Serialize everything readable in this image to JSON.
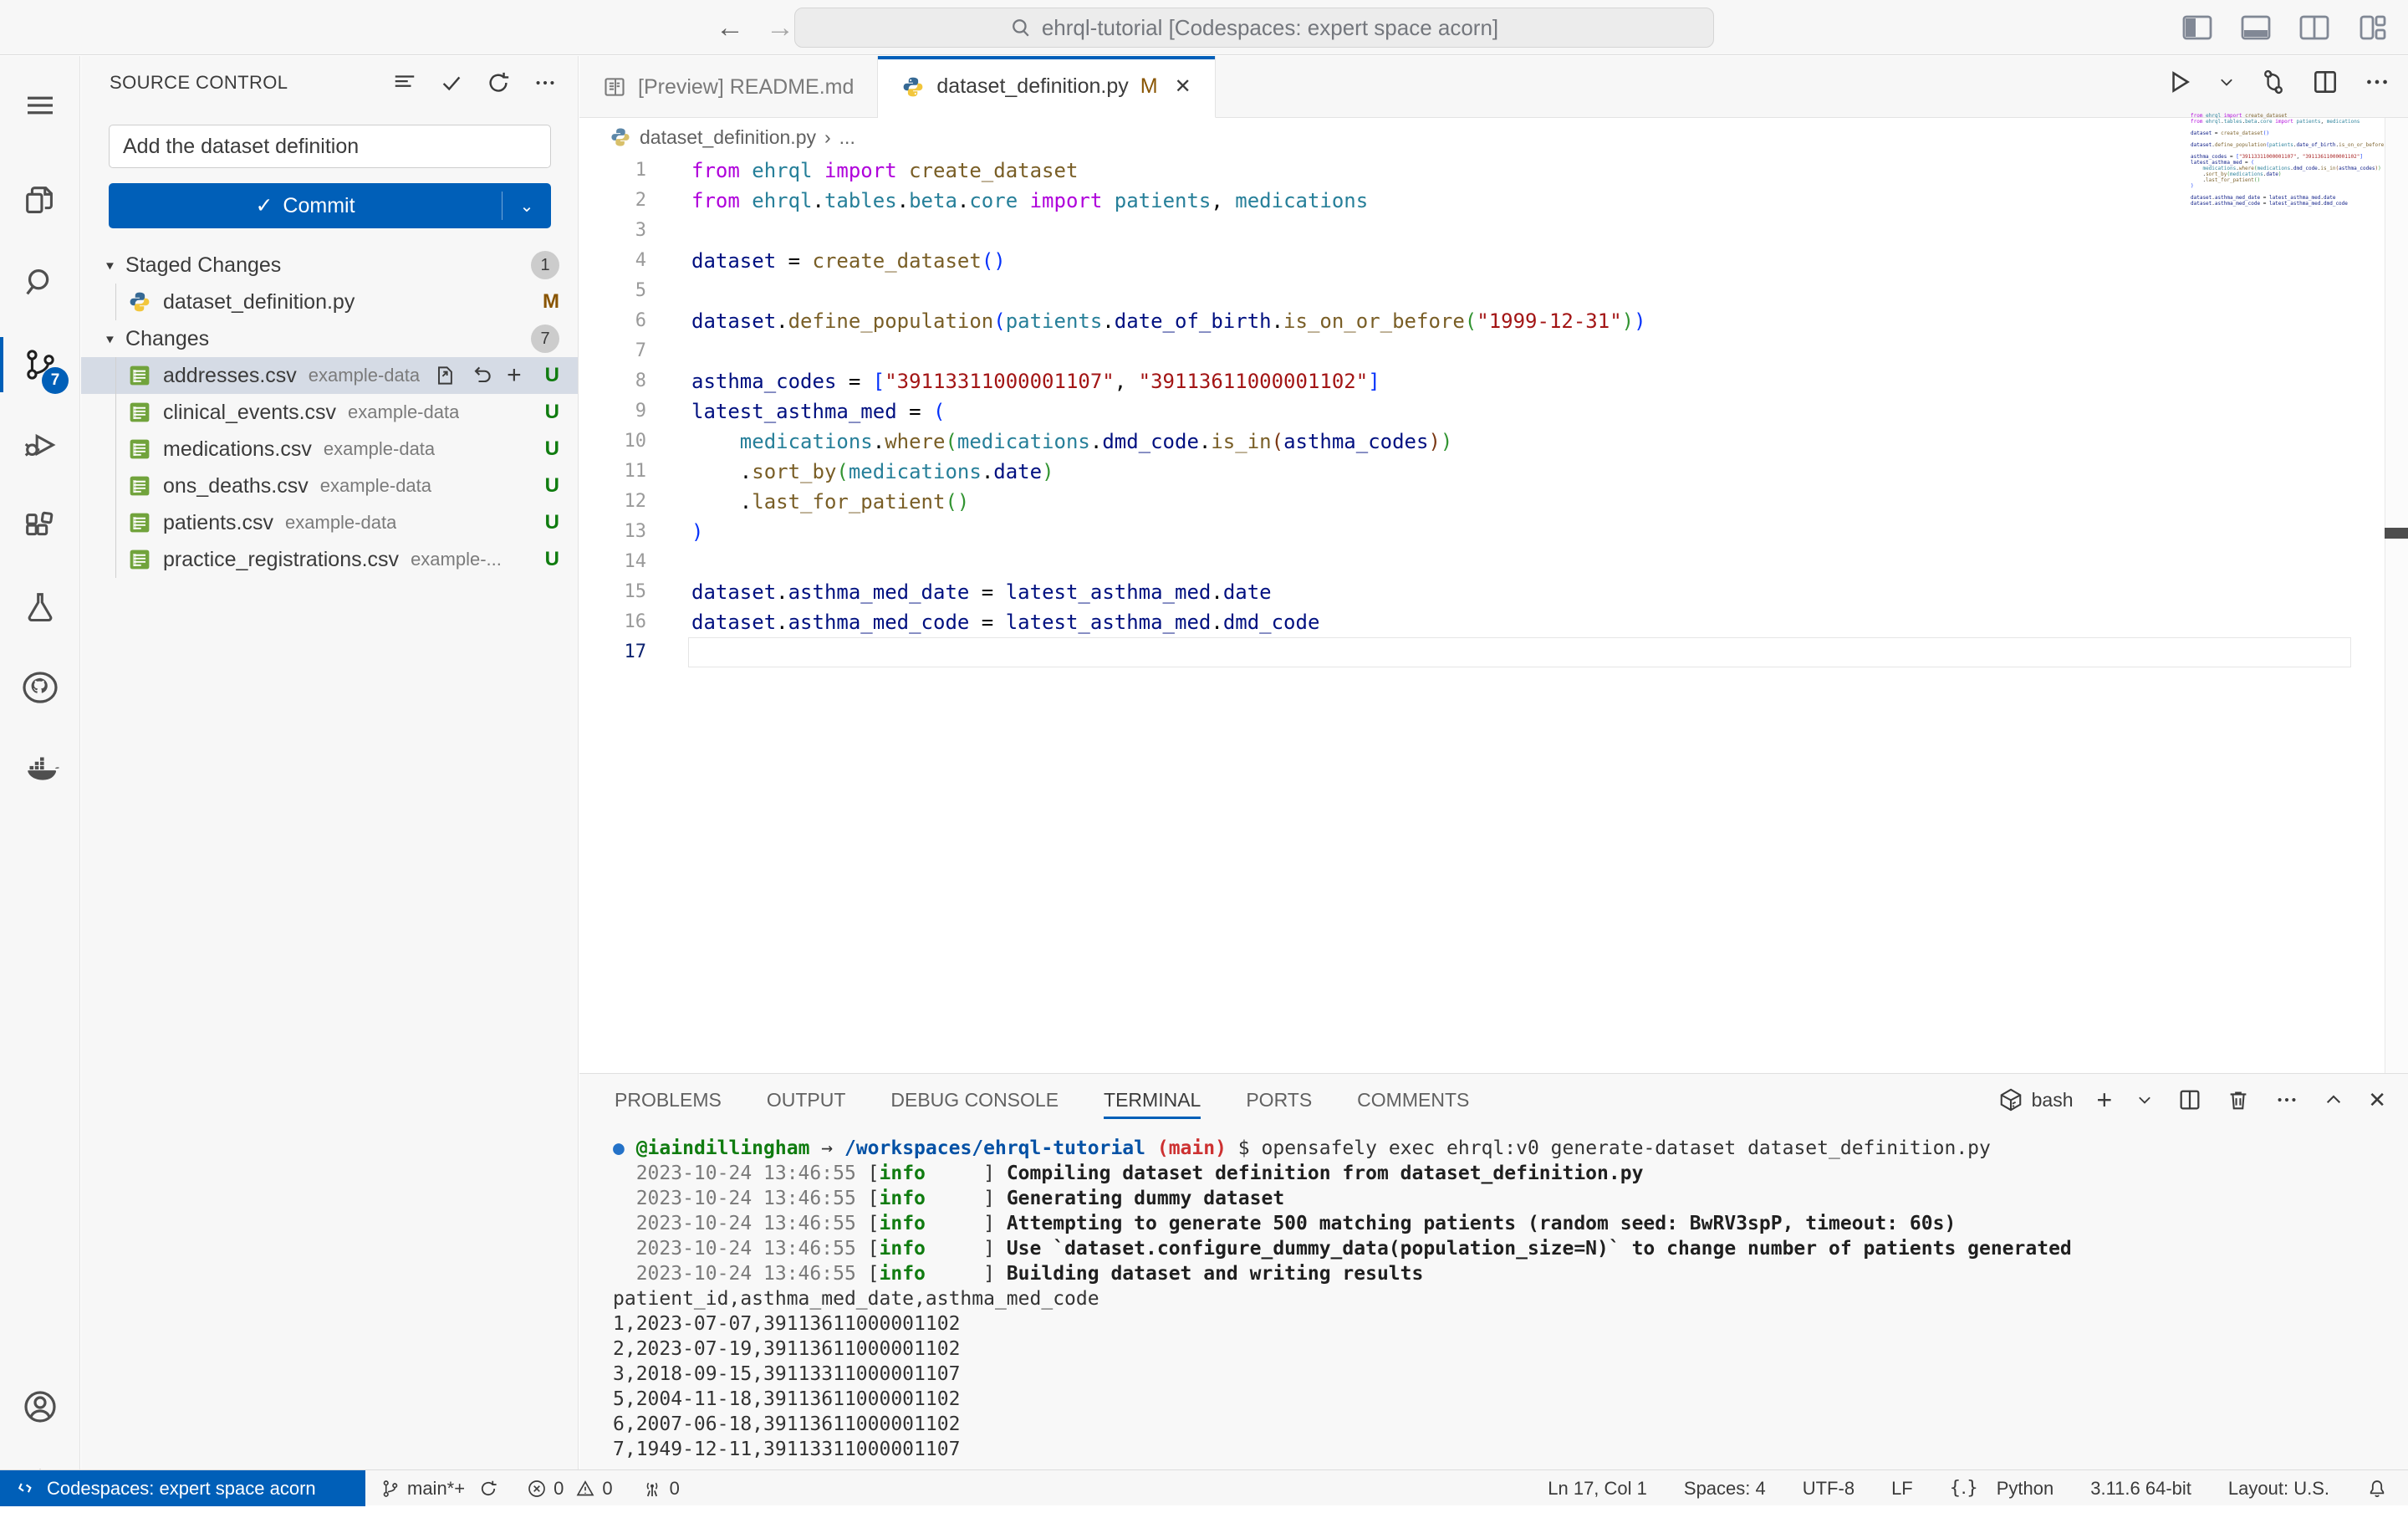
{
  "title_bar": {
    "back": "←",
    "forward": "→",
    "search_value": "ehrql-tutorial [Codespaces: expert space acorn]"
  },
  "activity_bar": {
    "items": [
      "menu",
      "explorer",
      "search",
      "source-control",
      "run-debug",
      "extensions",
      "testing",
      "github",
      "docker"
    ],
    "scm_badge": "7"
  },
  "sidebar": {
    "title": "SOURCE CONTROL",
    "commit_input_value": "Add the dataset definition",
    "commit_button_label": "Commit",
    "sections": [
      {
        "label": "Staged Changes",
        "badge": "1",
        "files": [
          {
            "name": "dataset_definition.py",
            "desc": "",
            "status": "M",
            "icon": "python",
            "selected": false,
            "actions": false
          }
        ]
      },
      {
        "label": "Changes",
        "badge": "7",
        "files": [
          {
            "name": "addresses.csv",
            "desc": "example-data",
            "status": "U",
            "icon": "csv",
            "selected": true,
            "actions": true
          },
          {
            "name": "clinical_events.csv",
            "desc": "example-data",
            "status": "U",
            "icon": "csv",
            "selected": false,
            "actions": false
          },
          {
            "name": "medications.csv",
            "desc": "example-data",
            "status": "U",
            "icon": "csv",
            "selected": false,
            "actions": false
          },
          {
            "name": "ons_deaths.csv",
            "desc": "example-data",
            "status": "U",
            "icon": "csv",
            "selected": false,
            "actions": false
          },
          {
            "name": "patients.csv",
            "desc": "example-data",
            "status": "U",
            "icon": "csv",
            "selected": false,
            "actions": false
          },
          {
            "name": "practice_registrations.csv",
            "desc": "example-...",
            "status": "U",
            "icon": "csv",
            "selected": false,
            "actions": false
          }
        ]
      }
    ]
  },
  "editor": {
    "tabs": [
      {
        "label": "[Preview] README.md",
        "active": false,
        "modified": "",
        "closable": false
      },
      {
        "label": "dataset_definition.py",
        "active": true,
        "modified": "M",
        "closable": true
      }
    ],
    "breadcrumb": {
      "file": "dataset_definition.py",
      "sep": "›",
      "more": "..."
    },
    "code_lines": [
      {
        "num": "1",
        "segs": [
          [
            "kw",
            "from"
          ],
          [
            "def",
            " "
          ],
          [
            "mod",
            "ehrql"
          ],
          [
            "def",
            " "
          ],
          [
            "kw",
            "import"
          ],
          [
            "def",
            " "
          ],
          [
            "fn",
            "create_dataset"
          ]
        ]
      },
      {
        "num": "2",
        "segs": [
          [
            "kw",
            "from"
          ],
          [
            "def",
            " "
          ],
          [
            "mod",
            "ehrql"
          ],
          [
            "def",
            "."
          ],
          [
            "mod",
            "tables"
          ],
          [
            "def",
            "."
          ],
          [
            "mod",
            "beta"
          ],
          [
            "def",
            "."
          ],
          [
            "mod",
            "core"
          ],
          [
            "def",
            " "
          ],
          [
            "kw",
            "import"
          ],
          [
            "def",
            " "
          ],
          [
            "mod",
            "patients"
          ],
          [
            "def",
            ", "
          ],
          [
            "mod",
            "medications"
          ]
        ]
      },
      {
        "num": "3",
        "segs": []
      },
      {
        "num": "4",
        "segs": [
          [
            "var",
            "dataset"
          ],
          [
            "def",
            " = "
          ],
          [
            "fn",
            "create_dataset"
          ],
          [
            "p1",
            "()"
          ]
        ]
      },
      {
        "num": "5",
        "segs": []
      },
      {
        "num": "6",
        "segs": [
          [
            "var",
            "dataset"
          ],
          [
            "def",
            "."
          ],
          [
            "fn",
            "define_population"
          ],
          [
            "p1",
            "("
          ],
          [
            "mod",
            "patients"
          ],
          [
            "def",
            "."
          ],
          [
            "var",
            "date_of_birth"
          ],
          [
            "def",
            "."
          ],
          [
            "fn",
            "is_on_or_before"
          ],
          [
            "p2",
            "("
          ],
          [
            "str",
            "\"1999-12-31\""
          ],
          [
            "p2",
            ")"
          ],
          [
            "p1",
            ")"
          ]
        ]
      },
      {
        "num": "7",
        "segs": []
      },
      {
        "num": "8",
        "segs": [
          [
            "var",
            "asthma_codes"
          ],
          [
            "def",
            " = "
          ],
          [
            "p1",
            "["
          ],
          [
            "str",
            "\"39113311000001107\""
          ],
          [
            "def",
            ", "
          ],
          [
            "str",
            "\"39113611000001102\""
          ],
          [
            "p1",
            "]"
          ]
        ]
      },
      {
        "num": "9",
        "segs": [
          [
            "var",
            "latest_asthma_med"
          ],
          [
            "def",
            " = "
          ],
          [
            "p1",
            "("
          ]
        ]
      },
      {
        "num": "10",
        "segs": [
          [
            "def",
            "    "
          ],
          [
            "mod",
            "medications"
          ],
          [
            "def",
            "."
          ],
          [
            "fn",
            "where"
          ],
          [
            "p2",
            "("
          ],
          [
            "mod",
            "medications"
          ],
          [
            "def",
            "."
          ],
          [
            "var",
            "dmd_code"
          ],
          [
            "def",
            "."
          ],
          [
            "fn",
            "is_in"
          ],
          [
            "p3",
            "("
          ],
          [
            "var",
            "asthma_codes"
          ],
          [
            "p3",
            ")"
          ],
          [
            "p2",
            ")"
          ]
        ]
      },
      {
        "num": "11",
        "segs": [
          [
            "def",
            "    ."
          ],
          [
            "fn",
            "sort_by"
          ],
          [
            "p2",
            "("
          ],
          [
            "mod",
            "medications"
          ],
          [
            "def",
            "."
          ],
          [
            "var",
            "date"
          ],
          [
            "p2",
            ")"
          ]
        ]
      },
      {
        "num": "12",
        "segs": [
          [
            "def",
            "    ."
          ],
          [
            "fn",
            "last_for_patient"
          ],
          [
            "p2",
            "()"
          ]
        ]
      },
      {
        "num": "13",
        "segs": [
          [
            "p1",
            ")"
          ]
        ]
      },
      {
        "num": "14",
        "segs": []
      },
      {
        "num": "15",
        "segs": [
          [
            "var",
            "dataset"
          ],
          [
            "def",
            "."
          ],
          [
            "var",
            "asthma_med_date"
          ],
          [
            "def",
            " = "
          ],
          [
            "var",
            "latest_asthma_med"
          ],
          [
            "def",
            "."
          ],
          [
            "var",
            "date"
          ]
        ]
      },
      {
        "num": "16",
        "segs": [
          [
            "var",
            "dataset"
          ],
          [
            "def",
            "."
          ],
          [
            "var",
            "asthma_med_code"
          ],
          [
            "def",
            " = "
          ],
          [
            "var",
            "latest_asthma_med"
          ],
          [
            "def",
            "."
          ],
          [
            "var",
            "dmd_code"
          ]
        ]
      },
      {
        "num": "17",
        "segs": [],
        "current": true
      }
    ]
  },
  "panel": {
    "tabs": [
      {
        "label": "PROBLEMS",
        "active": false
      },
      {
        "label": "OUTPUT",
        "active": false
      },
      {
        "label": "DEBUG CONSOLE",
        "active": false
      },
      {
        "label": "TERMINAL",
        "active": true
      },
      {
        "label": "PORTS",
        "active": false
      },
      {
        "label": "COMMENTS",
        "active": false
      }
    ],
    "shell_label": "bash",
    "terminal_lines": [
      {
        "segs": [
          [
            "dot",
            "● "
          ],
          [
            "user",
            "@iaindillingham"
          ],
          [
            "def",
            " → "
          ],
          [
            "path",
            "/workspaces/ehrql-tutorial"
          ],
          [
            "def",
            " "
          ],
          [
            "branch",
            "(main)"
          ],
          [
            "def",
            " $ opensafely exec ehrql:v0 generate-dataset dataset_definition.py"
          ]
        ]
      },
      {
        "segs": [
          [
            "ts",
            "  2023-10-24 13:46:55 "
          ],
          [
            "def",
            "["
          ],
          [
            "info",
            "info"
          ],
          [
            "def",
            "     ] "
          ],
          [
            "b",
            "Compiling dataset definition from dataset_definition.py"
          ]
        ]
      },
      {
        "segs": [
          [
            "ts",
            "  2023-10-24 13:46:55 "
          ],
          [
            "def",
            "["
          ],
          [
            "info",
            "info"
          ],
          [
            "def",
            "     ] "
          ],
          [
            "b",
            "Generating dummy dataset"
          ]
        ]
      },
      {
        "segs": [
          [
            "ts",
            "  2023-10-24 13:46:55 "
          ],
          [
            "def",
            "["
          ],
          [
            "info",
            "info"
          ],
          [
            "def",
            "     ] "
          ],
          [
            "b",
            "Attempting to generate 500 matching patients (random seed: BwRV3spP, timeout: 60s)"
          ]
        ]
      },
      {
        "segs": [
          [
            "ts",
            "  2023-10-24 13:46:55 "
          ],
          [
            "def",
            "["
          ],
          [
            "info",
            "info"
          ],
          [
            "def",
            "     ] "
          ],
          [
            "b",
            "Use `dataset.configure_dummy_data(population_size=N)` to change number of patients generated"
          ]
        ]
      },
      {
        "segs": [
          [
            "ts",
            "  2023-10-24 13:46:55 "
          ],
          [
            "def",
            "["
          ],
          [
            "info",
            "info"
          ],
          [
            "def",
            "     ] "
          ],
          [
            "b",
            "Building dataset and writing results"
          ]
        ]
      },
      {
        "segs": [
          [
            "def",
            "patient_id,asthma_med_date,asthma_med_code"
          ]
        ]
      },
      {
        "segs": [
          [
            "def",
            "1,2023-07-07,39113611000001102"
          ]
        ]
      },
      {
        "segs": [
          [
            "def",
            "2,2023-07-19,39113611000001102"
          ]
        ]
      },
      {
        "segs": [
          [
            "def",
            "3,2018-09-15,39113311000001107"
          ]
        ]
      },
      {
        "segs": [
          [
            "def",
            "5,2004-11-18,39113611000001102"
          ]
        ]
      },
      {
        "segs": [
          [
            "def",
            "6,2007-06-18,39113611000001102"
          ]
        ]
      },
      {
        "segs": [
          [
            "def",
            "7,1949-12-11,39113311000001107"
          ]
        ]
      }
    ]
  },
  "status_bar": {
    "remote": "Codespaces: expert space acorn",
    "branch": "main*+",
    "errors": "0",
    "warnings": "0",
    "ports": "0",
    "line_col": "Ln 17, Col 1",
    "spaces": "Spaces: 4",
    "encoding": "UTF-8",
    "eol": "LF",
    "language": "Python",
    "runtime": "3.11.6 64-bit",
    "layout": "Layout: U.S."
  },
  "colors": {
    "accent": "#005fb8",
    "modified": "#895503",
    "untracked": "#107c10"
  }
}
